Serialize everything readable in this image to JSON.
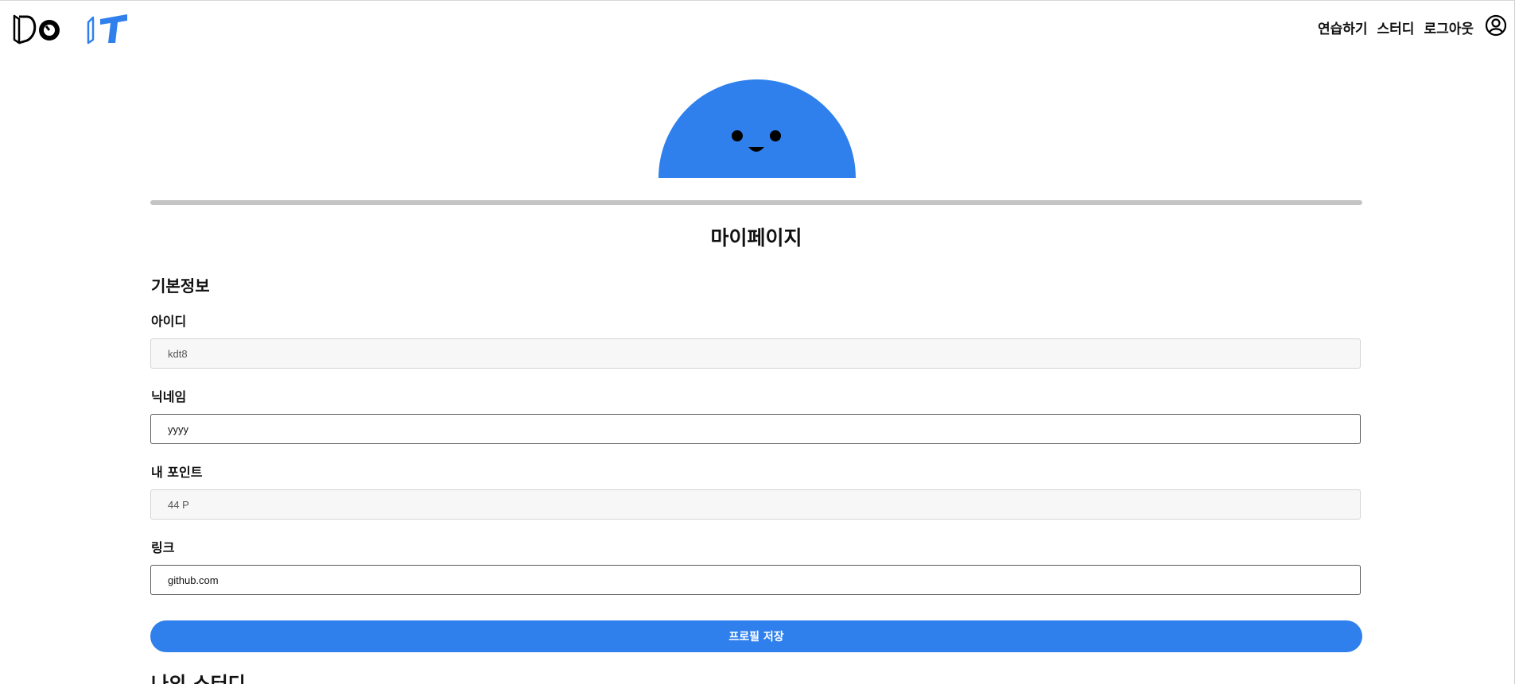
{
  "brand": {
    "logo_text": "Do IT",
    "accent_color": "#2f80ed"
  },
  "nav": {
    "items": [
      {
        "label": "연습하기"
      },
      {
        "label": "스터디"
      },
      {
        "label": "로그아웃"
      }
    ],
    "user_icon": "user-circle-icon"
  },
  "mascot": {
    "icon": "smiling-blue-half-circle",
    "color": "#2f80ed"
  },
  "page": {
    "title": "마이페이지"
  },
  "basic_info": {
    "section_title": "기본정보",
    "fields": [
      {
        "label": "아이디",
        "value": "kdt8",
        "readonly": true
      },
      {
        "label": "닉네임",
        "value": "yyyy",
        "readonly": false
      },
      {
        "label": "내 포인트",
        "value": "44 P",
        "readonly": true
      },
      {
        "label": "링크",
        "value": "github.com",
        "readonly": false
      }
    ],
    "save_label": "프로필 저장"
  },
  "next_section": {
    "title": "나의 스터디"
  }
}
